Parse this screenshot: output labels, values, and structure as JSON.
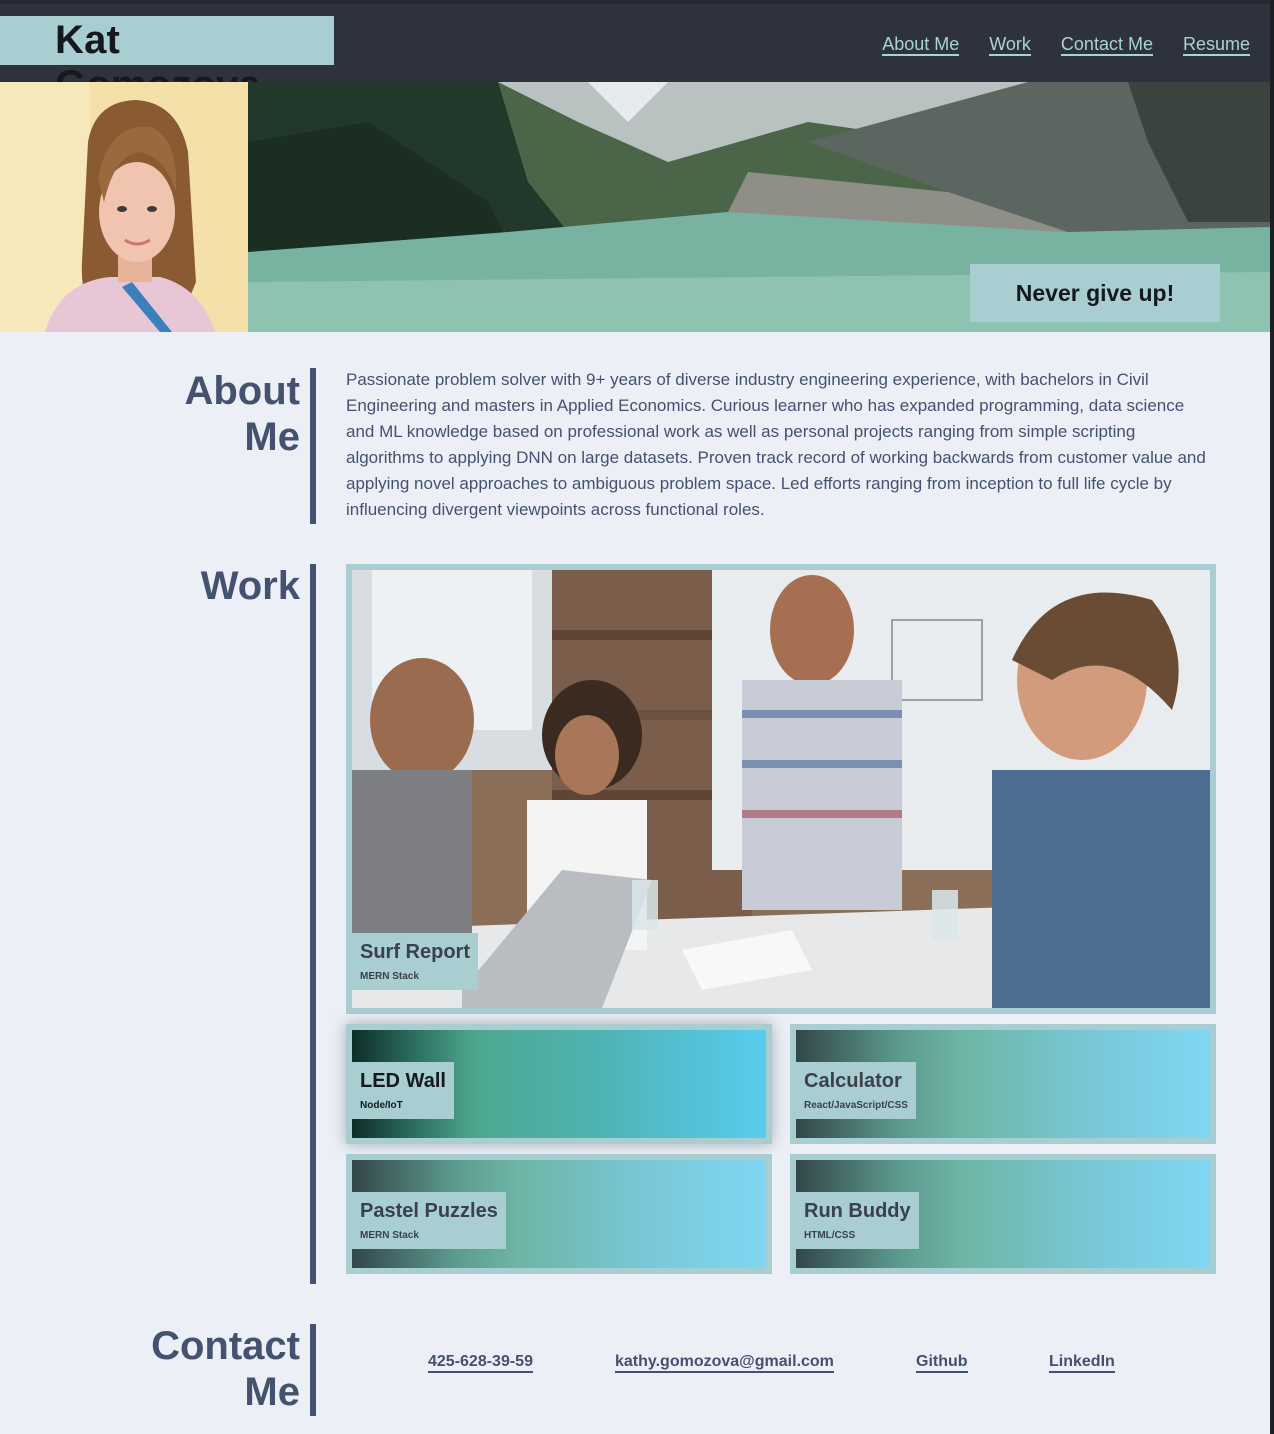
{
  "header": {
    "name": "Kat Gomozova",
    "nav": [
      "About Me",
      "Work",
      "Contact Me",
      "Resume"
    ]
  },
  "hero": {
    "motto": "Never give up!"
  },
  "about": {
    "title_line1": "About",
    "title_line2": "Me",
    "text": "Passionate problem solver with 9+ years of diverse industry engineering experience, with bachelors in Civil Engineering and masters in Applied Economics. Curious learner who has expanded programming, data science and ML knowledge based on professional work as well as personal projects ranging from simple scripting algorithms to applying DNN on large datasets. Proven track record of working backwards from customer value and applying novel approaches to ambiguous problem space. Led efforts ranging from inception to full life cycle by influencing divergent viewpoints across functional roles."
  },
  "work": {
    "title": "Work",
    "projects": [
      {
        "name": "Surf Report",
        "stack": "MERN Stack"
      },
      {
        "name": "LED Wall",
        "stack": "Node/IoT"
      },
      {
        "name": "Calculator",
        "stack": "React/JavaScript/CSS"
      },
      {
        "name": "Pastel Puzzles",
        "stack": "MERN Stack"
      },
      {
        "name": "Run Buddy",
        "stack": "HTML/CSS"
      }
    ]
  },
  "contact": {
    "title_line1": "Contact",
    "title_line2": "Me",
    "phone": "425-628-39-59",
    "email": "kathy.gomozova@gmail.com",
    "github": "Github",
    "linkedin": "LinkedIn"
  },
  "colors": {
    "header_bg": "#2e323d",
    "accent": "#a8ced2",
    "text": "#44516f",
    "page_bg": "#eceff6"
  }
}
